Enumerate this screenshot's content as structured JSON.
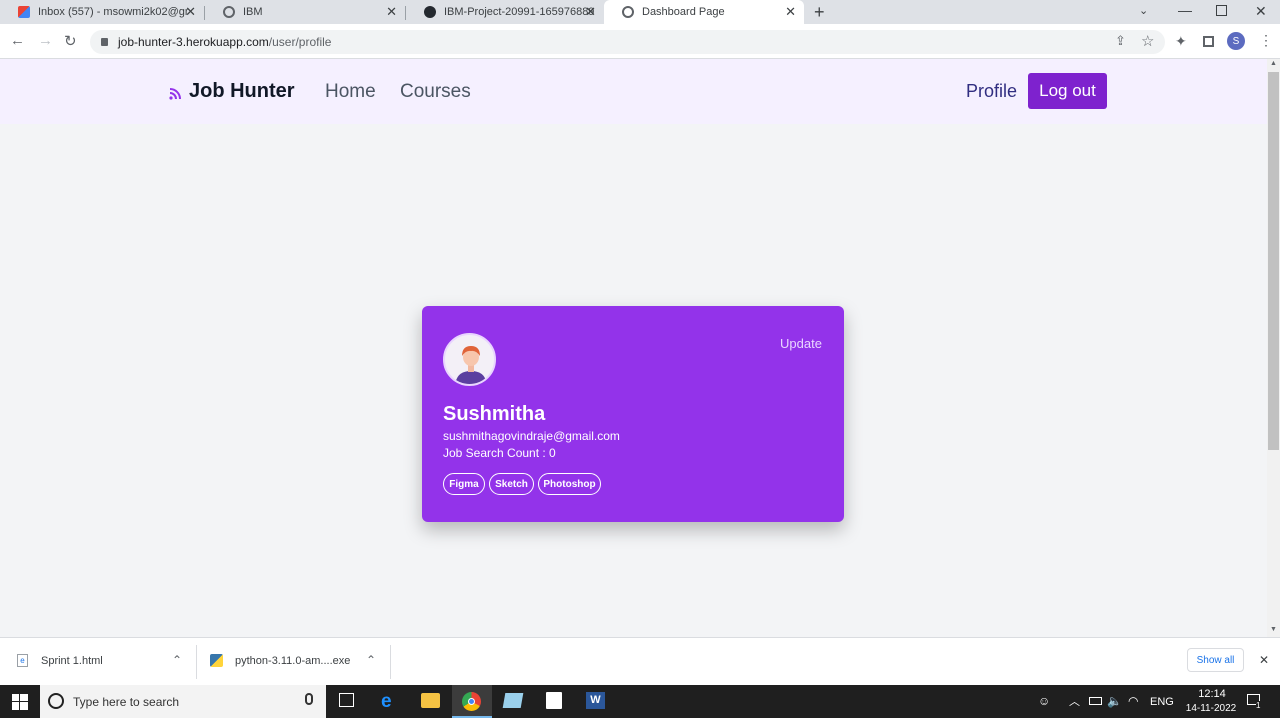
{
  "browser": {
    "tabs": [
      {
        "title": "Inbox (557) - msowmi2k02@gma",
        "icon": "gmail-icon"
      },
      {
        "title": "IBM",
        "icon": "globe-icon"
      },
      {
        "title": "IBM-Project-20991-1659768892/",
        "icon": "github-icon"
      },
      {
        "title": "Dashboard Page",
        "icon": "globe-icon",
        "active": true
      }
    ],
    "url_domain": "job-hunter-3.herokuapp.com",
    "url_path": "/user/profile",
    "profile_initial": "S"
  },
  "navbar": {
    "brand": "Job Hunter",
    "links": [
      "Home",
      "Courses"
    ],
    "profile": "Profile",
    "logout": "Log out"
  },
  "profile_card": {
    "update": "Update",
    "name": "Sushmitha",
    "email": "sushmithagovindraje@gmail.com",
    "job_search_count": "Job Search Count : 0",
    "skills": [
      "Figma",
      "Sketch",
      "Photoshop"
    ]
  },
  "downloads": {
    "items": [
      "Sprint 1.html",
      "python-3.11.0-am....exe"
    ],
    "show_all": "Show all"
  },
  "taskbar": {
    "search_placeholder": "Type here to search",
    "language": "ENG",
    "time": "12:14",
    "date": "14-11-2022",
    "notification_count": "1"
  },
  "colors": {
    "accent": "#9333ea",
    "logout_bg": "#7e22ce",
    "nav_bg": "#f5f0ff",
    "profile_link": "#312e81"
  }
}
